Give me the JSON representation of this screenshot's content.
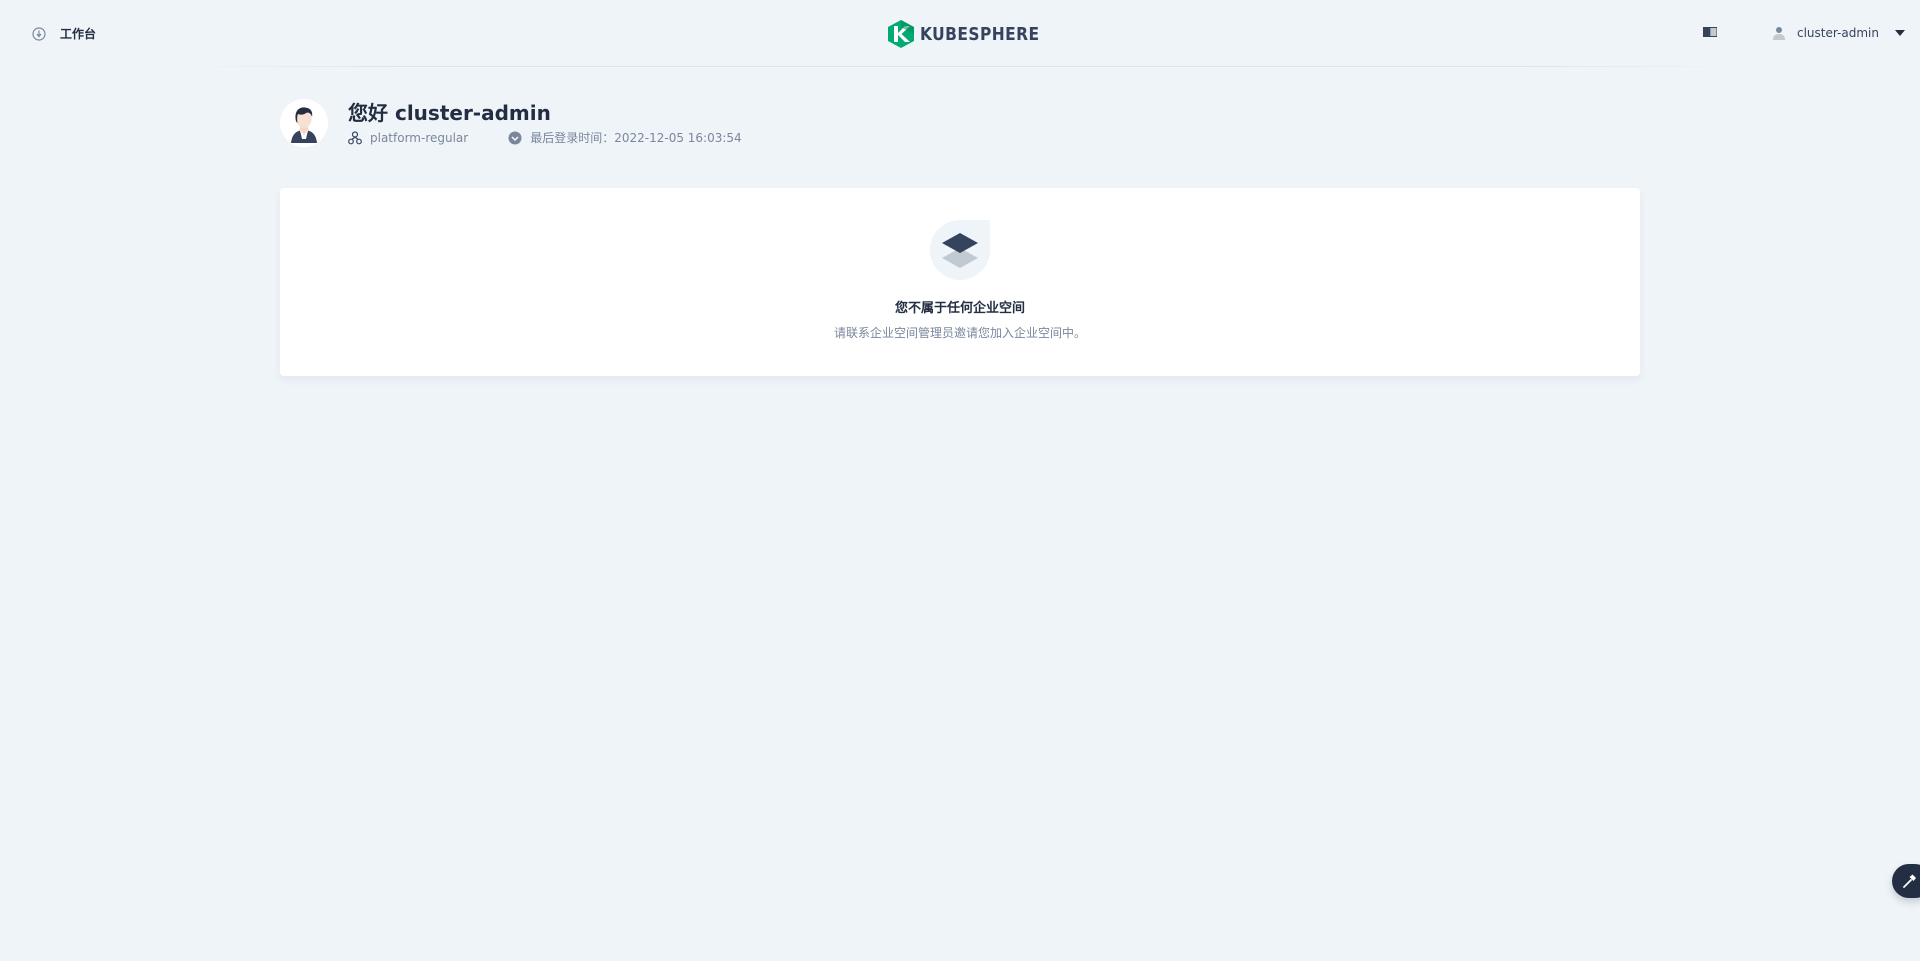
{
  "header": {
    "workbench_label": "工作台",
    "logo_text": "KUBESPHERE",
    "user_name": "cluster-admin"
  },
  "profile": {
    "greeting": "您好 cluster-admin",
    "role": "platform-regular",
    "last_login": "最后登录时间：2022-12-05 16:03:54"
  },
  "empty_state": {
    "title": "您不属于任何企业空间",
    "description": "请联系企业空间管理员邀请您加入企业空间中。"
  },
  "icons": {
    "workbench": "workbench-icon",
    "theme": "theme-toggle-icon",
    "user": "user-icon",
    "caret": "caret-down-icon",
    "role": "role-icon",
    "clock": "clock-icon",
    "empty": "workspace-layers-icon",
    "tool": "hammer-icon"
  },
  "colors": {
    "background": "#eff4f9",
    "logo_green": "#00aa72",
    "text_primary": "#242e42",
    "text_secondary": "#79879c",
    "dark": "#36435c"
  }
}
